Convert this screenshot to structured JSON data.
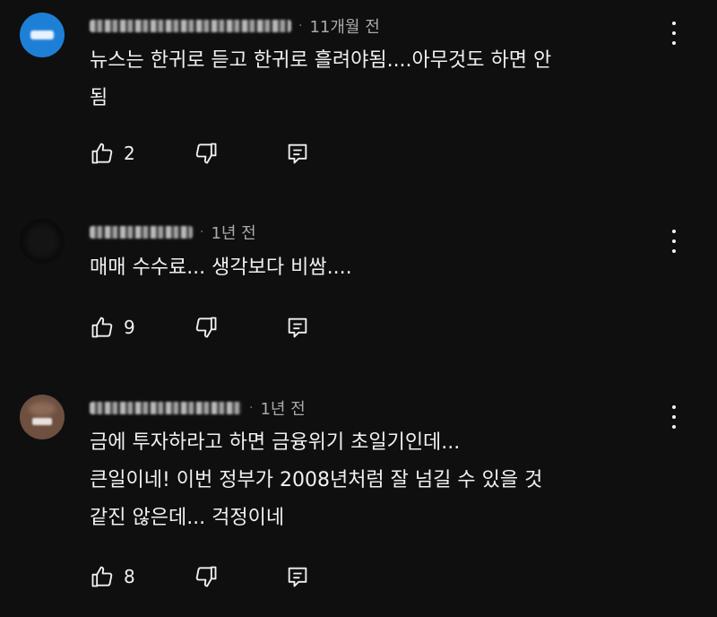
{
  "comments": [
    {
      "time": "11개월 전",
      "lines": [
        "뉴스는  한귀로 듣고  한귀로 흘려야됨....아무것도 하면 안",
        "됨"
      ],
      "likes": "2",
      "avatar_color": "#1e88e5"
    },
    {
      "time": "1년 전",
      "lines": [
        "매매 수수료... 생각보다 비쌈...."
      ],
      "likes": "9",
      "avatar_color": "#111111"
    },
    {
      "time": "1년 전",
      "lines": [
        "금에 투자하라고 하면 금융위기 초일기인데...",
        "큰일이네! 이번 정부가 2008년처럼 잘 넘길 수 있을 것",
        "같진 않은데... 걱정이네"
      ],
      "likes": "8",
      "avatar_color": "#7a5a48"
    }
  ],
  "icons": {
    "like": "thumb-up-icon",
    "dislike": "thumb-down-icon",
    "reply": "reply-icon",
    "menu": "kebab-menu-icon"
  }
}
